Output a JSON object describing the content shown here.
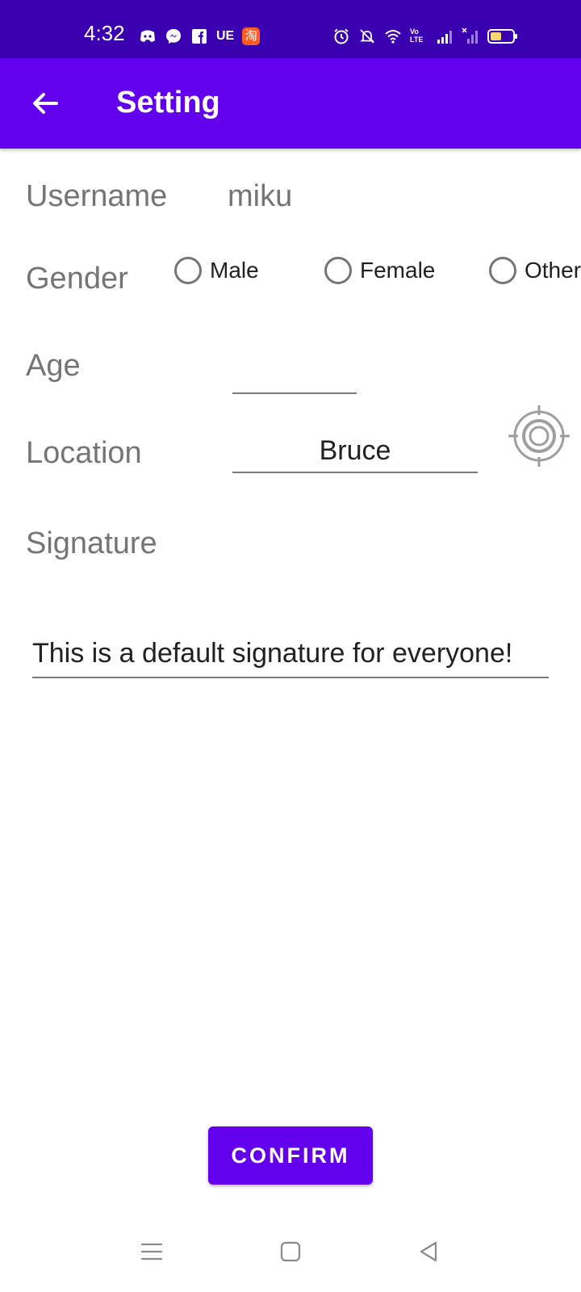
{
  "status_bar": {
    "time": "4:32",
    "left_icons": [
      "discord-icon",
      "messenger-icon",
      "facebook-icon",
      "ue-icon",
      "taobao-icon"
    ],
    "ue_text": "UE",
    "taobao_text": "淘",
    "right_icons": [
      "alarm-icon",
      "silent-bell-icon",
      "wifi-icon",
      "volte-icon",
      "signal-icon",
      "signal-x-icon",
      "battery-icon"
    ],
    "volte_text": "Vo LTE",
    "battery_color": "#f5d76e"
  },
  "app_bar": {
    "title": "Setting",
    "color": "#6200ee"
  },
  "form": {
    "username_label": "Username",
    "username_value": "miku",
    "gender_label": "Gender",
    "gender_options": [
      "Male",
      "Female",
      "Other"
    ],
    "age_label": "Age",
    "age_value": "",
    "location_label": "Location",
    "location_value": "Bruce",
    "signature_label": "Signature",
    "signature_value": "This is a default signature for everyone!"
  },
  "confirm_label": "CONFIRM",
  "accent_color": "#6200ee"
}
